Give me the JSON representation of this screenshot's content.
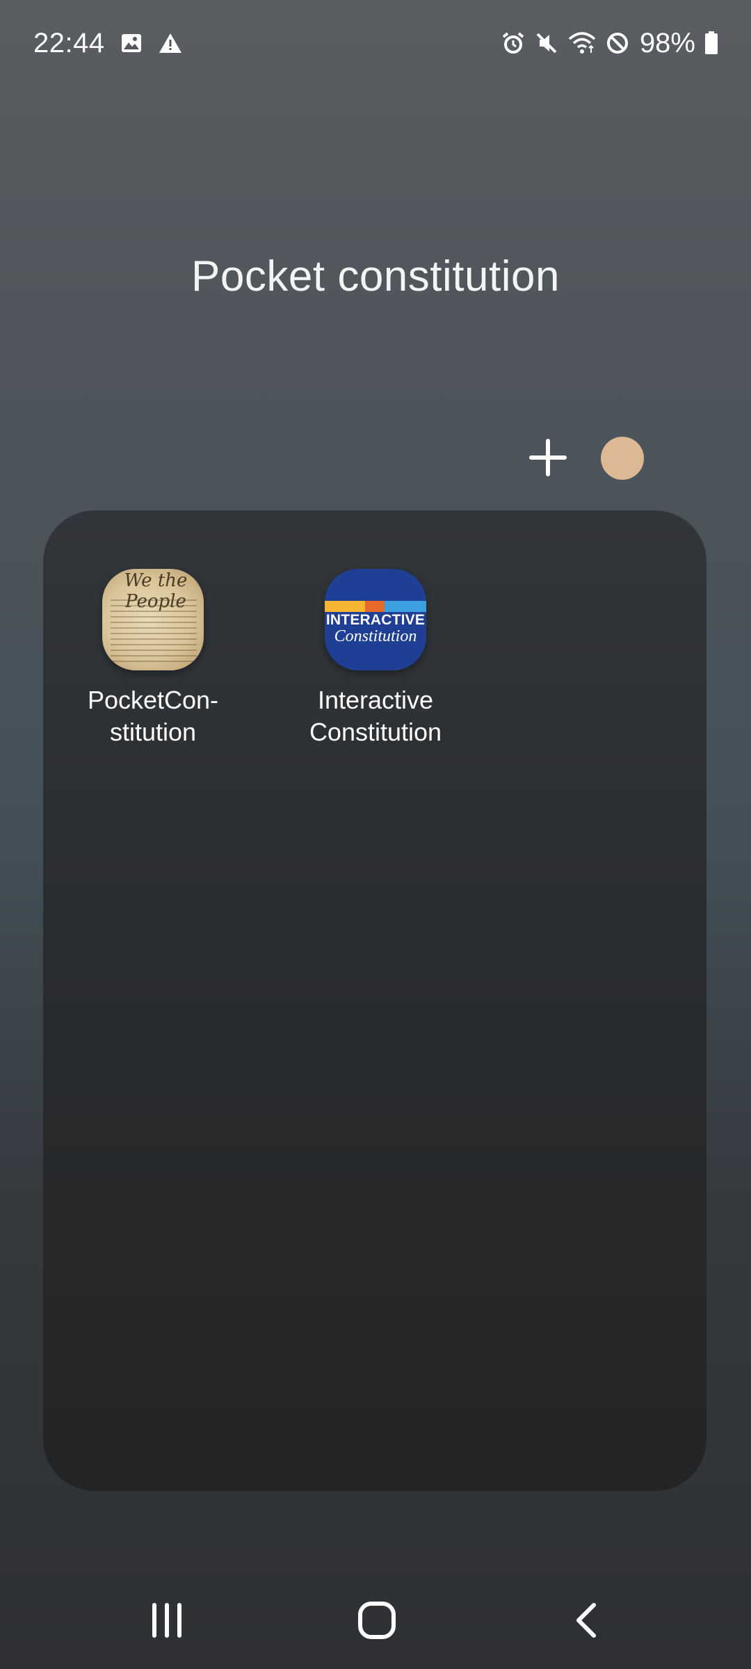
{
  "status_bar": {
    "time": "22:44",
    "left_icons": [
      "image-icon",
      "warning-icon"
    ],
    "right_icons": [
      "alarm-icon",
      "mute-icon",
      "wifi-icon",
      "do-not-disturb-icon"
    ],
    "battery_percent": "98%"
  },
  "folder": {
    "title": "Pocket constitution",
    "color_swatch": "#dcb894",
    "apps": [
      {
        "label": "PocketCon-\nstitution",
        "icon_text": "We the People"
      },
      {
        "label": "Interactive\nConstitution",
        "icon_line1": "INTERACTIVE",
        "icon_line2": "Constitution"
      }
    ]
  },
  "nav_bar": {
    "buttons": [
      "recent-apps-icon",
      "home-icon",
      "back-icon"
    ]
  },
  "colors": {
    "accent_swatch": "#dcb894",
    "interactive_blue": "#1f3f94"
  }
}
